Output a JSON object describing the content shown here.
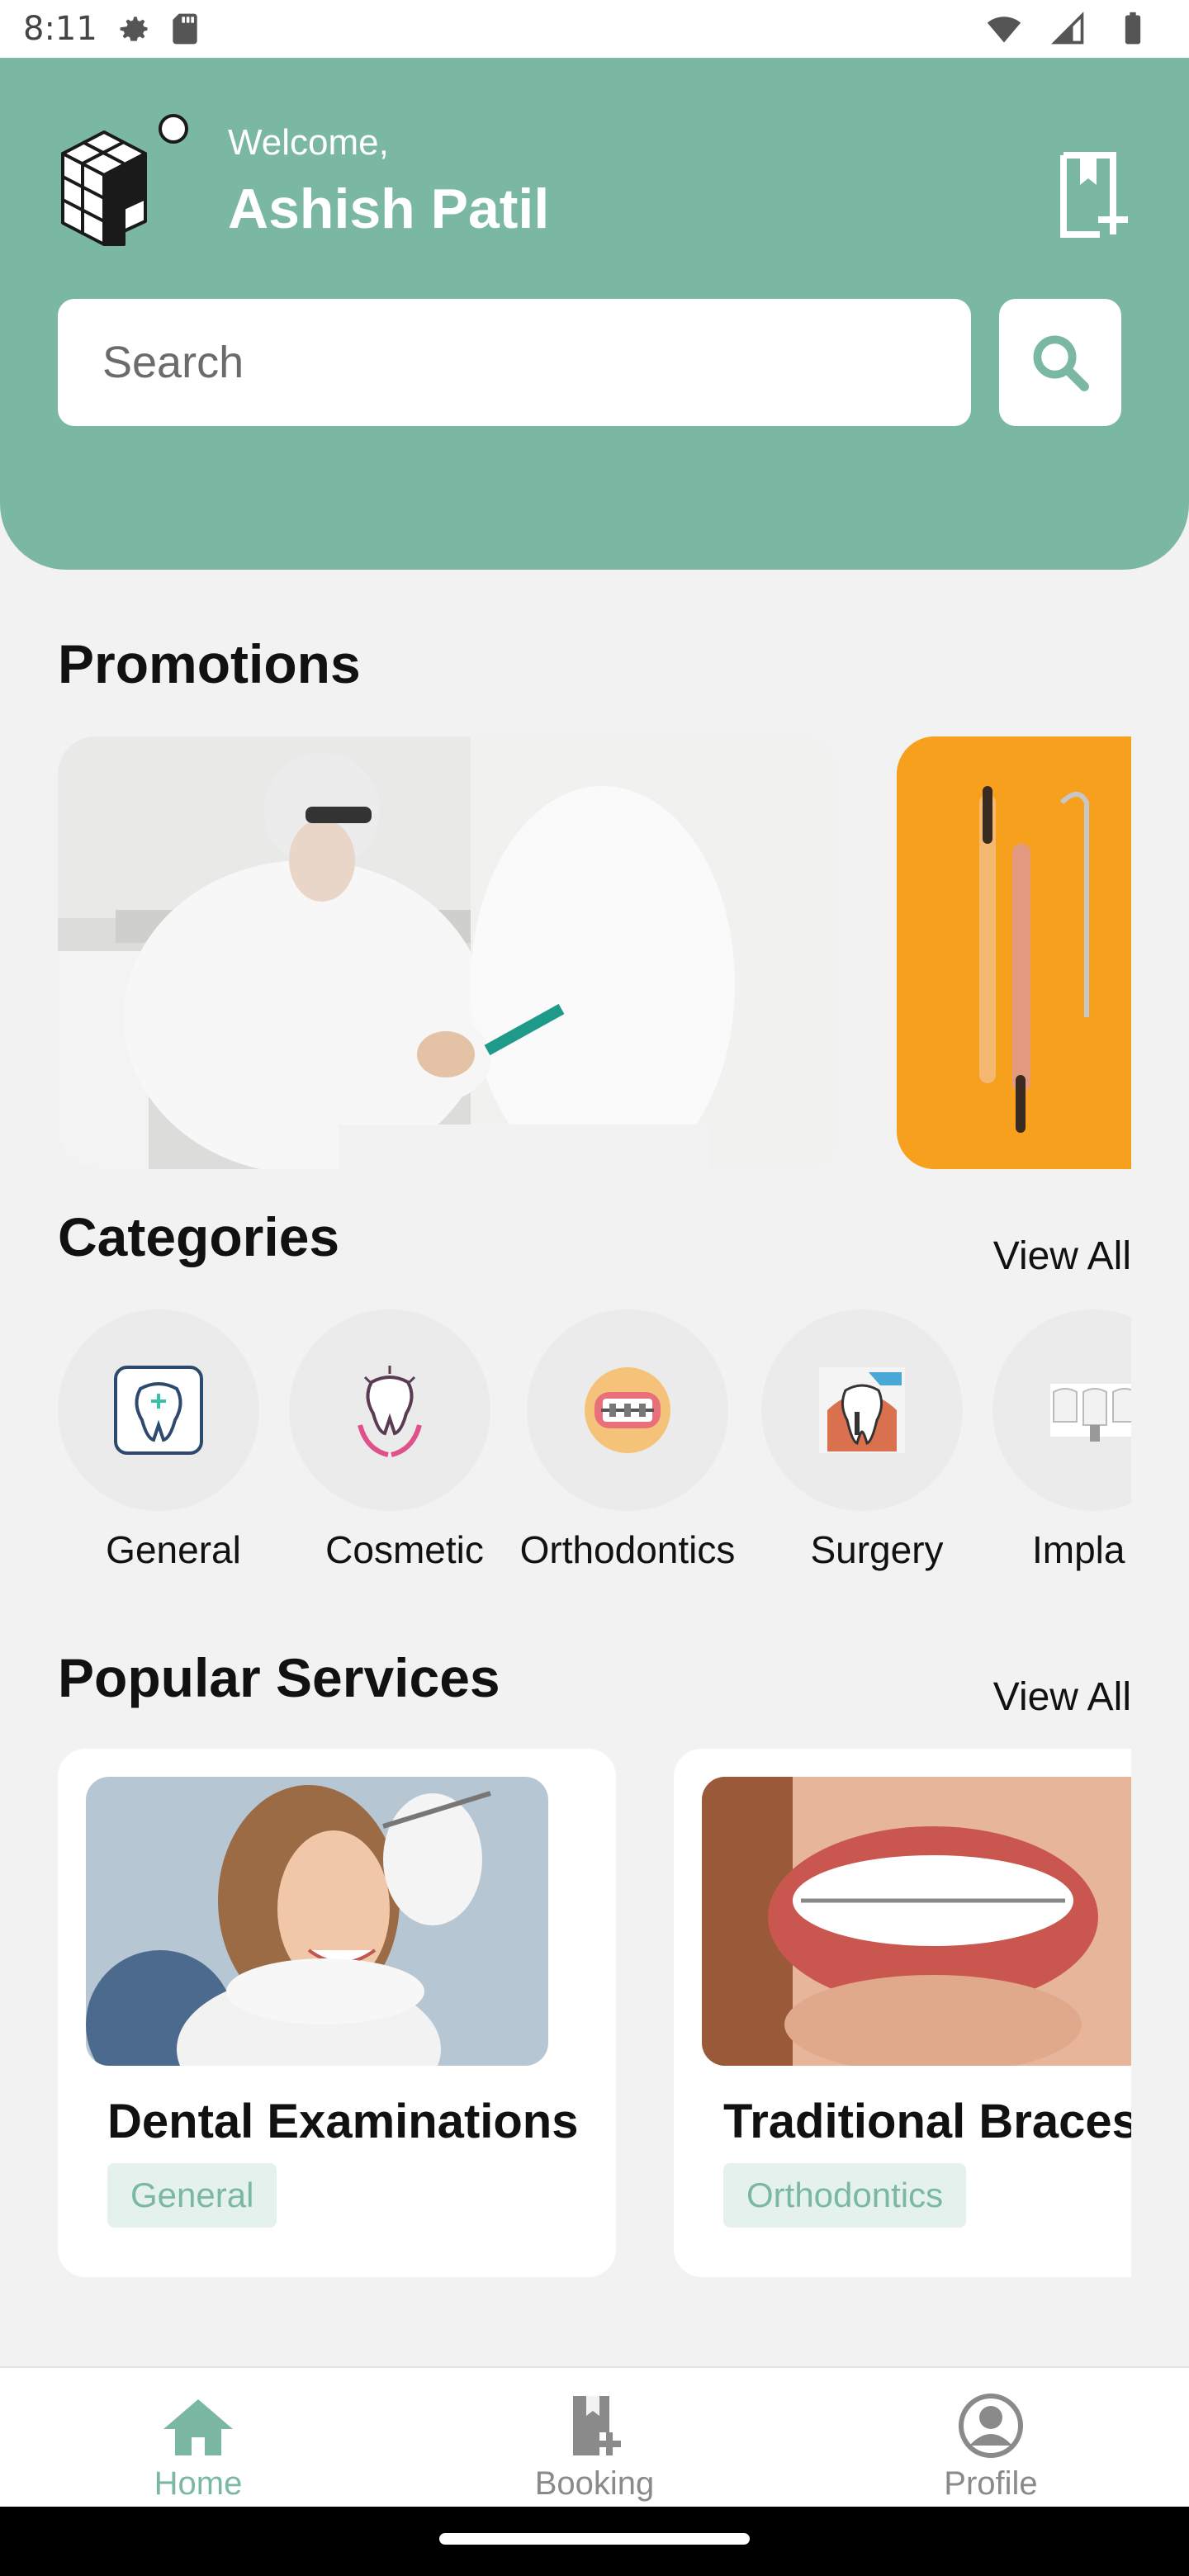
{
  "status_bar": {
    "time": "8:11"
  },
  "header": {
    "welcome": "Welcome,",
    "user_name": "Ashish Patil",
    "search_placeholder": "Search"
  },
  "promotions": {
    "title": "Promotions"
  },
  "categories": {
    "title": "Categories",
    "view_all": "View All",
    "items": [
      {
        "label": "General"
      },
      {
        "label": "Cosmetic"
      },
      {
        "label": "Orthodontics"
      },
      {
        "label": "Surgery"
      },
      {
        "label": "Impla"
      }
    ]
  },
  "popular_services": {
    "title": "Popular Services",
    "view_all": "View All",
    "items": [
      {
        "name": "Dental Examinations",
        "tag": "General"
      },
      {
        "name": "Traditional Braces",
        "tag": "Orthodontics"
      }
    ]
  },
  "bottom_nav": {
    "items": [
      {
        "label": "Home",
        "active": true
      },
      {
        "label": "Booking",
        "active": false
      },
      {
        "label": "Profile",
        "active": false
      }
    ]
  },
  "colors": {
    "primary": "#7bb8a3",
    "tag_bg": "#e5f1ec",
    "background": "#f2f2f2",
    "inactive": "#8a8a8a",
    "promo_orange": "#f7a01e"
  }
}
